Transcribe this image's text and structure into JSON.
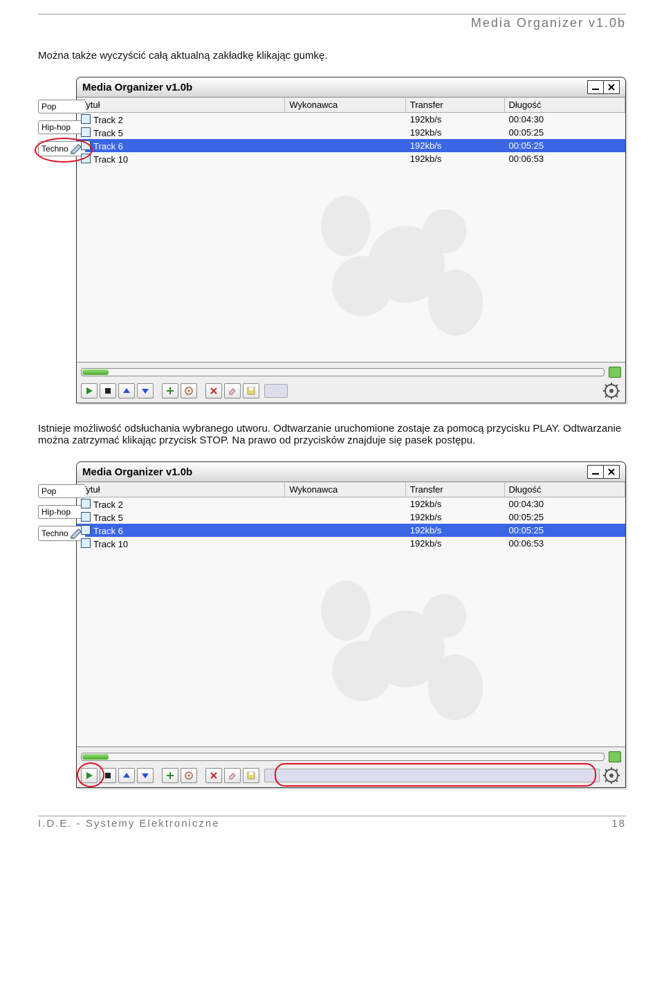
{
  "header": {
    "title": "Media Organizer v1.0b"
  },
  "para1": "Można także wyczyścić całą aktualną zakładkę klikając gumkę.",
  "para2_a": "Istnieje możliwość odsłuchania wybranego utworu. Odtwarzanie uruchomione zostaje za pomocą przycisku PLAY. Odtwarzanie można zatrzymać klikając przycisk STOP. Na prawo od przycisków znajduje się pasek postępu.",
  "app": {
    "title": "Media Organizer v1.0b",
    "tabs": [
      "Pop",
      "Hip-hop",
      "Techno"
    ],
    "cols": {
      "title": "Tytuł",
      "artist": "Wykonawca",
      "transfer": "Transfer",
      "length": "Długość"
    },
    "rows": [
      {
        "title": "Track 2",
        "artist": "",
        "transfer": "192kb/s",
        "length": "00:04:30",
        "selected": false
      },
      {
        "title": "Track 5",
        "artist": "",
        "transfer": "192kb/s",
        "length": "00:05:25",
        "selected": false
      },
      {
        "title": "Track 6",
        "artist": "",
        "transfer": "192kb/s",
        "length": "00:05:25",
        "selected": true
      },
      {
        "title": "Track 10",
        "artist": "",
        "transfer": "192kb/s",
        "length": "00:06:53",
        "selected": false
      }
    ]
  },
  "footer": {
    "left": "I.D.E. - Systemy Elektroniczne",
    "right": "18"
  }
}
